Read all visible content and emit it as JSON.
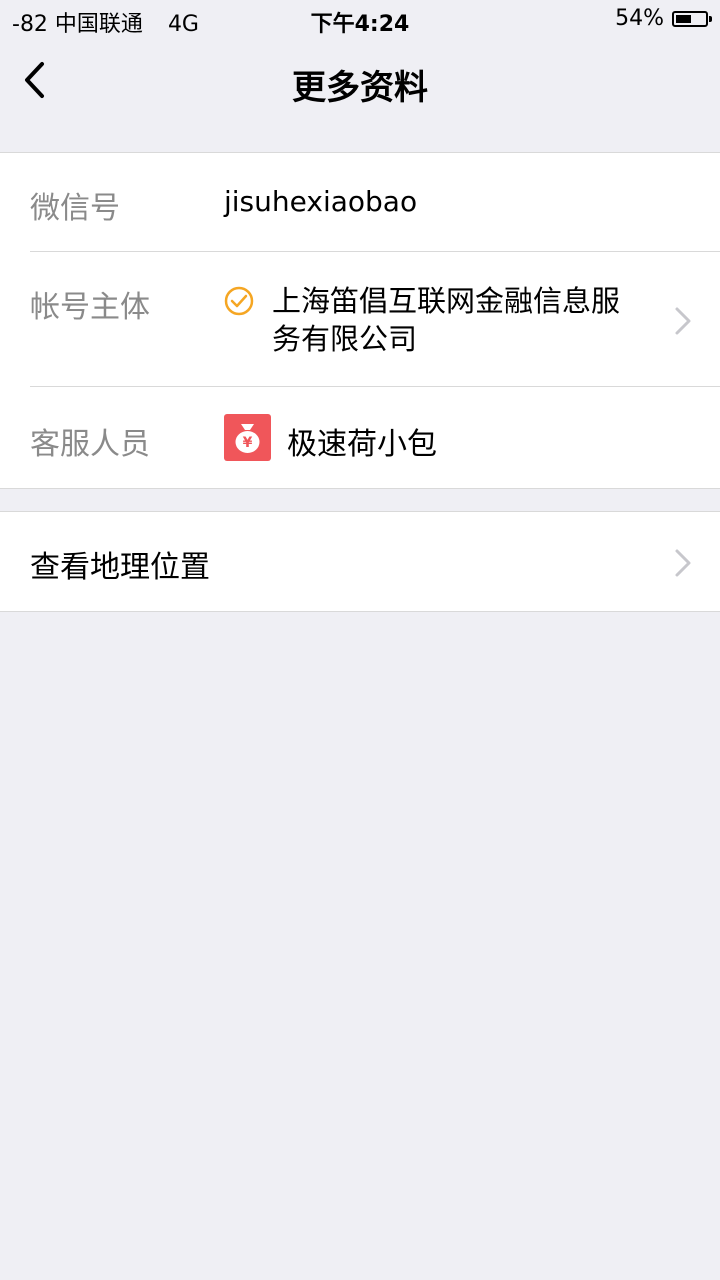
{
  "status_bar": {
    "signal": "-82 中国联通",
    "network": "4G",
    "time": "下午4:24",
    "battery": "54%",
    "battery_level": 0.54
  },
  "nav": {
    "title": "更多资料",
    "back_icon": "chevron-left-icon"
  },
  "info": {
    "wechat_id": {
      "label": "微信号",
      "value": "jisuhexiaobao"
    },
    "account_entity": {
      "label": "帐号主体",
      "value_line1": "上海笛倡互联网金融信息服",
      "value_line2": "务有限公司",
      "icon": "verified-check-icon"
    },
    "customer_service": {
      "label": "客服人员",
      "name": "极速荷小包",
      "icon": "money-bag-app-icon"
    }
  },
  "location": {
    "label": "查看地理位置"
  },
  "colors": {
    "background": "#efeff4",
    "label_gray": "#8a8a8a",
    "verified_orange": "#f5a623",
    "app_icon_red": "#f0565a",
    "divider": "#d9d9d9"
  }
}
